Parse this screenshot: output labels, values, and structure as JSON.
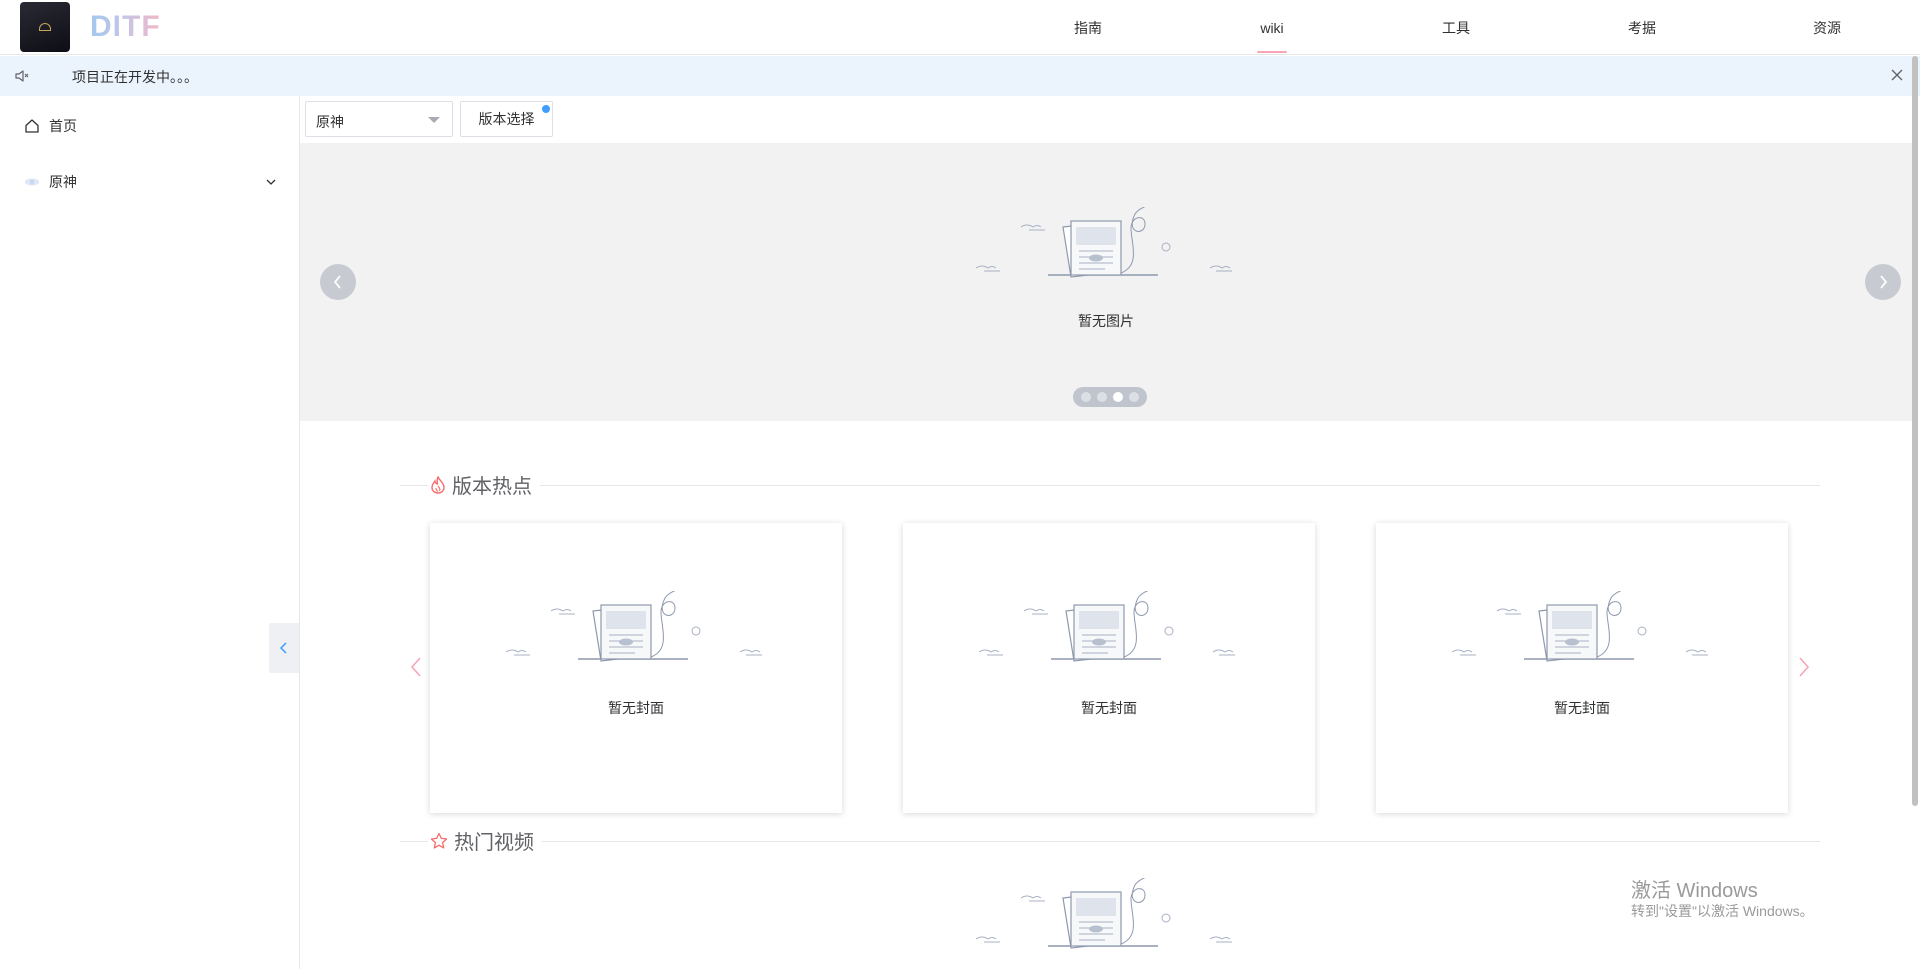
{
  "header": {
    "brand": "DITF",
    "nav": [
      {
        "label": "指南",
        "active": false
      },
      {
        "label": "wiki",
        "active": true
      },
      {
        "label": "工具",
        "active": false
      },
      {
        "label": "考据",
        "active": false
      },
      {
        "label": "资源",
        "active": false
      }
    ],
    "active_underline_color": "#f8a5b8"
  },
  "notice": {
    "text": "项目正在开发中。。。",
    "background": "#ebf3fd"
  },
  "sidebar": {
    "items": [
      {
        "label": "首页",
        "icon": "home-icon"
      },
      {
        "label": "原神",
        "icon": "genshin-icon",
        "expandable": true
      }
    ]
  },
  "toolbar": {
    "game_select_value": "原神",
    "version_button_label": "版本选择",
    "badge_color": "#409eff"
  },
  "carousel": {
    "empty_text": "暂无图片",
    "indicator_count": 4,
    "active_indicator": 3
  },
  "sections": {
    "hot_version": {
      "title": "版本热点",
      "icon": "fire-icon",
      "cards": [
        {
          "empty_text": "暂无封面"
        },
        {
          "empty_text": "暂无封面"
        },
        {
          "empty_text": "暂无封面"
        }
      ]
    },
    "hot_video": {
      "title": "热门视频",
      "icon": "star-icon"
    }
  },
  "watermark": {
    "line1": "激活 Windows",
    "line2": "转到\"设置\"以激活 Windows。"
  },
  "colors": {
    "accent_red": "#f56c6c",
    "arrow_pink": "#f8a5b8"
  }
}
